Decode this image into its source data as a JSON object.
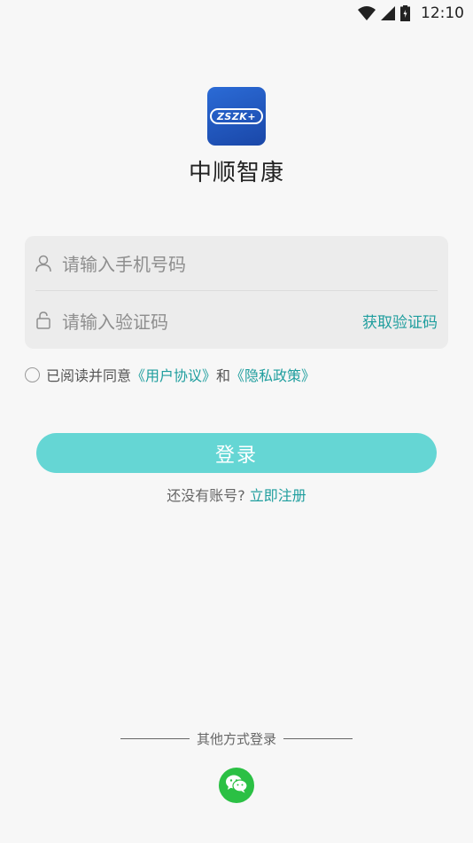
{
  "status_bar": {
    "time": "12:10",
    "icons": [
      "wifi-icon",
      "signal-icon",
      "battery-icon"
    ]
  },
  "app": {
    "logo_text": "ZSZK+",
    "name": "中顺智康"
  },
  "form": {
    "phone_placeholder": "请输入手机号码",
    "code_placeholder": "请输入验证码",
    "get_code_label": "获取验证码"
  },
  "agreement": {
    "prefix": "已阅读并同意",
    "user_agreement": "《用户协议》",
    "and": "和",
    "privacy_policy": "《隐私政策》"
  },
  "login_button": "登录",
  "register": {
    "prompt": "还没有账号?",
    "link": "立即注册"
  },
  "other_login": {
    "label": "其他方式登录",
    "options": [
      "wechat-icon"
    ]
  },
  "colors": {
    "accent": "#1f9e9e",
    "login_button": "#65d6d4",
    "wechat": "#2bc044",
    "logo": "#1f57c2"
  }
}
